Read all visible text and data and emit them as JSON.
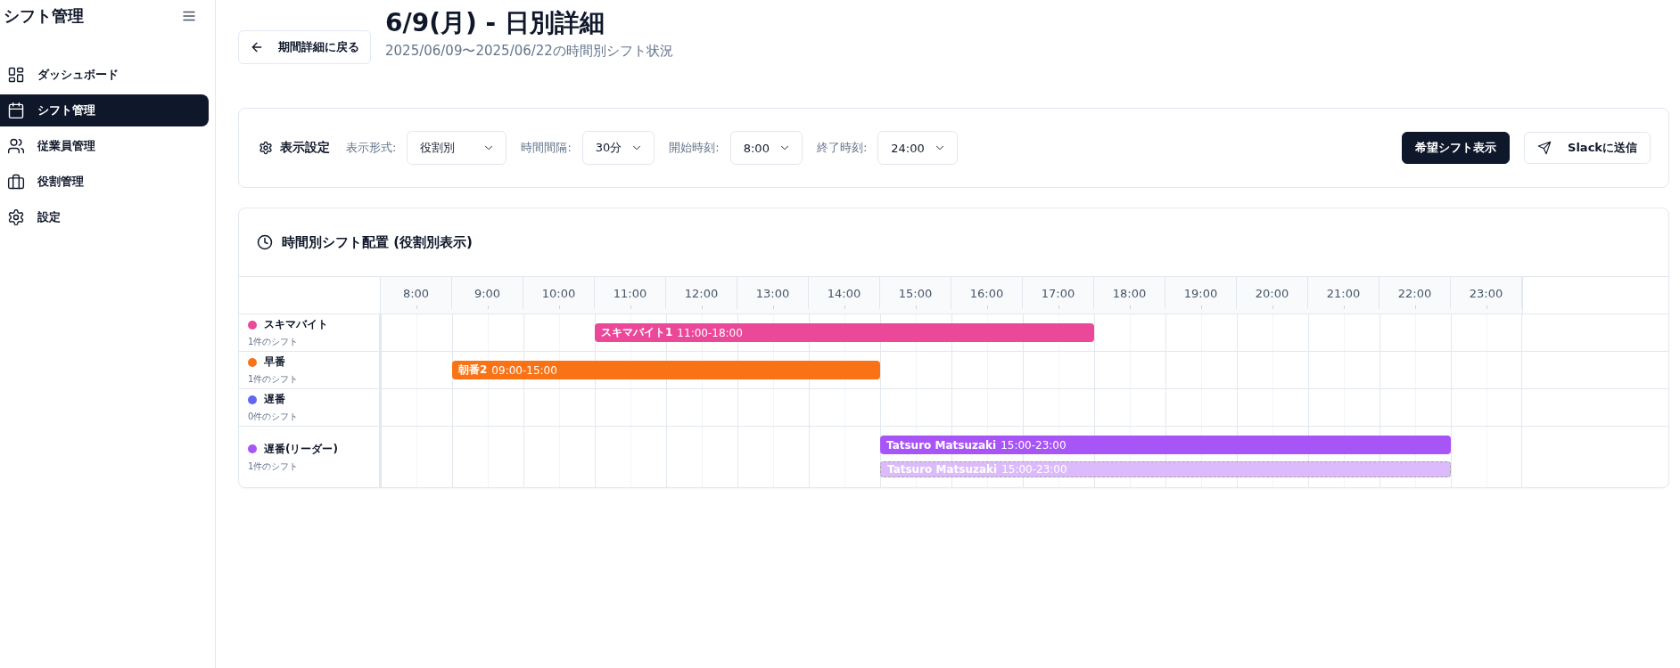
{
  "sidebar": {
    "title": "シフト管理",
    "items": [
      {
        "label": "ダッシュボード",
        "selected": false
      },
      {
        "label": "シフト管理",
        "selected": true
      },
      {
        "label": "従業員管理",
        "selected": false
      },
      {
        "label": "役割管理",
        "selected": false
      },
      {
        "label": "設定",
        "selected": false
      }
    ]
  },
  "header": {
    "back_button": "期間詳細に戻る",
    "title": "6/9(月) - 日別詳細",
    "subtitle": "2025/06/09〜2025/06/22の時間別シフト状況"
  },
  "settings": {
    "title": "表示設定",
    "fields": [
      {
        "label": "表示形式:",
        "value": "役割別"
      },
      {
        "label": "時間間隔:",
        "value": "30分"
      },
      {
        "label": "開始時刻:",
        "value": "8:00"
      },
      {
        "label": "終了時刻:",
        "value": "24:00"
      }
    ],
    "buttons": [
      {
        "label": "希望シフト表示",
        "kind": "primary"
      },
      {
        "label": "Slackに送信",
        "kind": "outline"
      }
    ]
  },
  "timeline": {
    "title": "時間別シフト配置 (役割別表示)",
    "hours": [
      "8:00",
      "9:00",
      "10:00",
      "11:00",
      "12:00",
      "13:00",
      "14:00",
      "15:00",
      "16:00",
      "17:00",
      "18:00",
      "19:00",
      "20:00",
      "21:00",
      "22:00",
      "23:00"
    ],
    "rows": [
      {
        "name": "スキマバイト",
        "color": "#ec4899",
        "count": "1件のシフト",
        "shifts": [
          {
            "name": "スキマバイト1",
            "time": "11:00-18:00",
            "kind": "assigned"
          }
        ]
      },
      {
        "name": "早番",
        "color": "#f97316",
        "count": "1件のシフト",
        "shifts": [
          {
            "name": "朝番2",
            "time": "09:00-15:00",
            "kind": "assigned"
          }
        ]
      },
      {
        "name": "遅番",
        "color": "#6366f1",
        "count": "0件のシフト",
        "shifts": []
      },
      {
        "name": "遅番(リーダー)",
        "color": "#a855f7",
        "count": "1件のシフト",
        "shifts": [
          {
            "name": "Tatsuro Matsuzaki",
            "time": "15:00-23:00",
            "kind": "assigned"
          },
          {
            "name": "Tatsuro Matsuzaki",
            "time": "15:00-23:00",
            "kind": "requested"
          }
        ]
      }
    ]
  }
}
